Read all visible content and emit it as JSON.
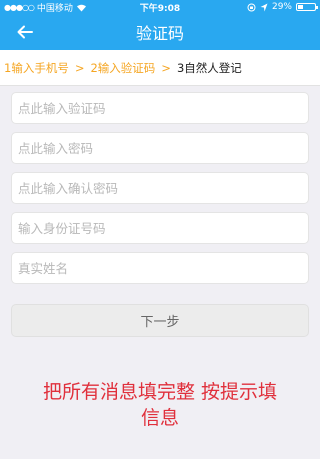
{
  "status_bar": {
    "carrier": "中国移动",
    "time": "下午9:08",
    "battery_percent_text": "29%",
    "battery_level": 0.29,
    "icons": [
      "signal-dots-icon",
      "wifi-icon",
      "orientation-lock-icon",
      "location-icon"
    ]
  },
  "nav": {
    "title": "验证码",
    "back_icon": "arrow-left-icon"
  },
  "steps": {
    "items": [
      "1输入手机号",
      "2输入验证码",
      "3自然人登记"
    ],
    "separator": ">"
  },
  "form": {
    "verification_code_placeholder": "点此输入验证码",
    "password_placeholder": "点此输入密码",
    "confirm_password_placeholder": "点此输入确认密码",
    "id_number_placeholder": "输入身份证号码",
    "real_name_placeholder": "真实姓名"
  },
  "next_button_label": "下一步",
  "hint_line1": "把所有消息填完整 按提示填",
  "hint_line2": "信息",
  "colors": {
    "accent": "#29a8f0",
    "step_done": "#f5a623",
    "hint": "#e0303c"
  }
}
